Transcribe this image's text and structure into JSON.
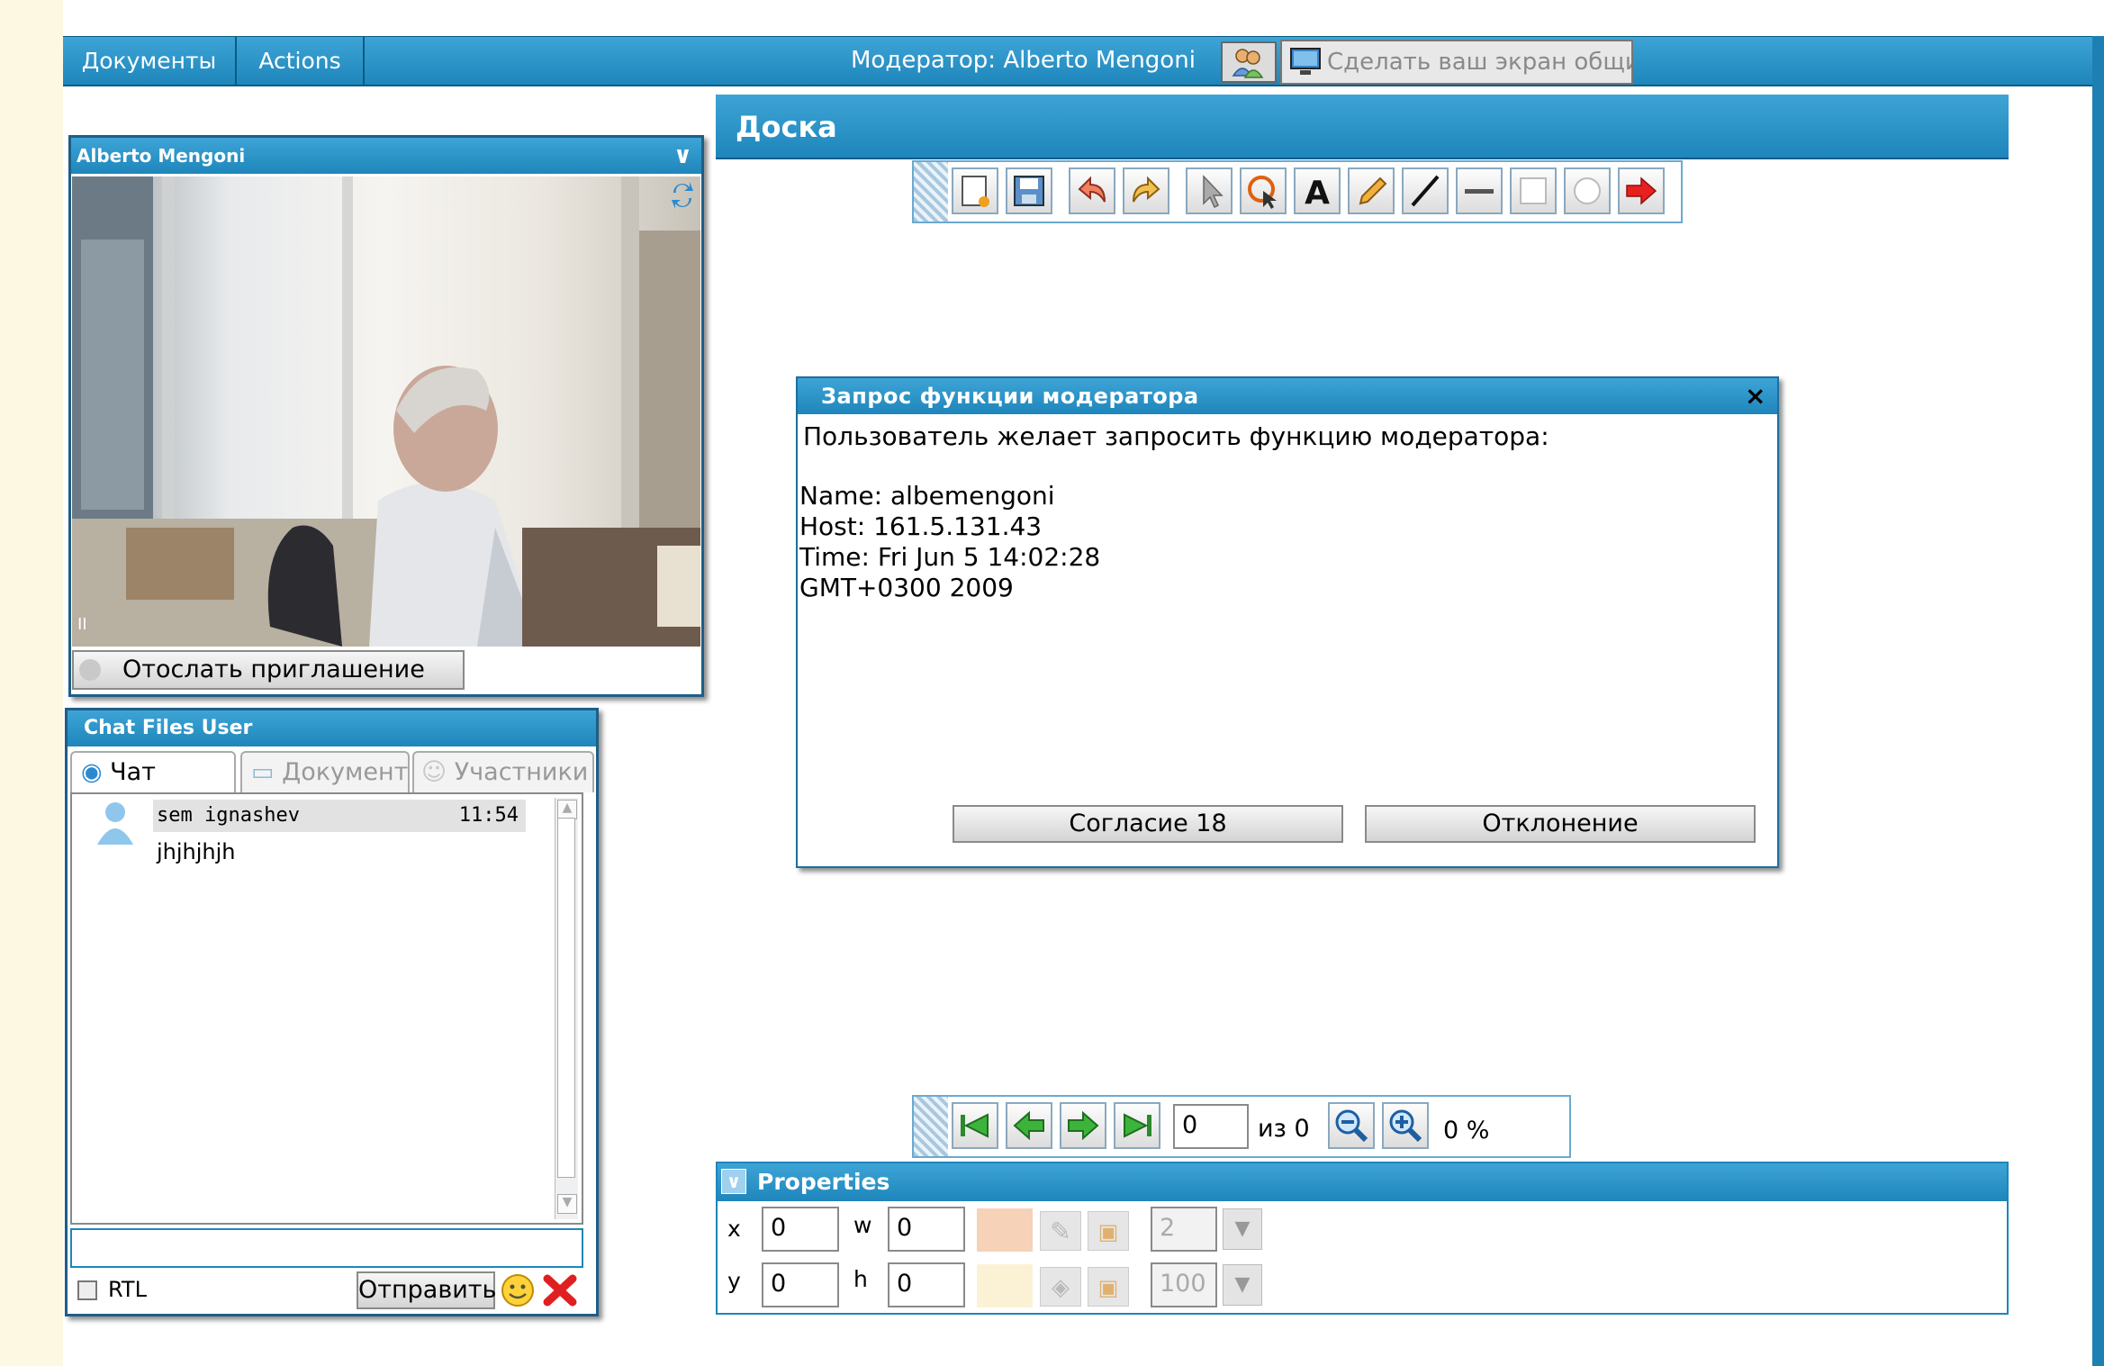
{
  "topbar": {
    "menu_documents": "Документы",
    "menu_actions": "Actions",
    "moderator_label": "Модератор: Alberto Mengoni",
    "screen_share_label": "Сделать ваш экран общим"
  },
  "video": {
    "title": "Alberto Mengoni",
    "invite_button": "Отослать приглашение"
  },
  "whiteboard": {
    "title": "Доска",
    "tools": [
      "new-page-icon",
      "save-icon",
      "undo-icon",
      "redo-icon",
      "pointer-icon",
      "select-icon",
      "text-icon",
      "pencil-icon",
      "line-icon",
      "underline-icon",
      "rectangle-icon",
      "ellipse-icon",
      "arrow-icon"
    ],
    "pager": {
      "page_value": "0",
      "of_label": "из 0",
      "zoom_label": "0 %"
    }
  },
  "dialog": {
    "title": "Запрос функции модератора",
    "intro": "Пользователь желает запросить функцию модератора:",
    "name_line": "Name: albemengoni",
    "host_line": "Host: 161.5.131.43",
    "time_line": "Time: Fri Jun 5 14:02:28",
    "tz_line": "GMT+0300 2009",
    "accept_button": "Согласие 18",
    "decline_button": "Отклонение"
  },
  "chat": {
    "title": "Chat Files User",
    "tabs": [
      "Чат",
      "Документы",
      "Участники"
    ],
    "message_user": "sem ignashev",
    "message_time": "11:54",
    "message_text": "jhjhjhjh",
    "rtl_label": "RTL",
    "send_button": "Отправить"
  },
  "properties": {
    "title": "Properties",
    "x_label": "x",
    "y_label": "y",
    "w_label": "w",
    "h_label": "h",
    "x_value": "0",
    "y_value": "0",
    "w_value": "0",
    "h_value": "0",
    "line_width": "2",
    "opacity": "100"
  },
  "colors": {
    "accent": "#1e86bb",
    "border_dark": "#0b5b85",
    "background": "#fdf8e2"
  }
}
